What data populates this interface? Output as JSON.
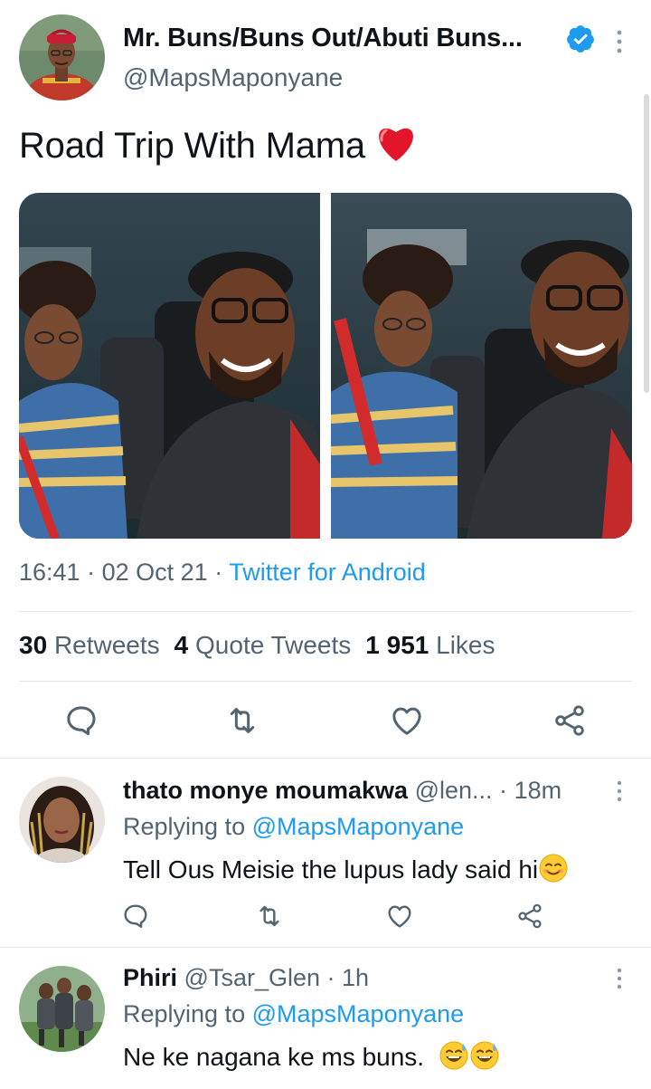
{
  "tweet": {
    "author_name": "Mr. Buns/Buns Out/Abuti Buns...",
    "author_handle": "@MapsMaponyane",
    "verified": true,
    "text": "Road Trip With Mama",
    "emoji": "heart-emoji",
    "time": "16:41",
    "date": "02 Oct 21",
    "separator": "·",
    "source": "Twitter for Android",
    "stats": {
      "retweets_count": "30",
      "retweets_label": "Retweets",
      "quotes_count": "4",
      "quotes_label": "Quote Tweets",
      "likes_count": "1 951",
      "likes_label": "Likes"
    },
    "photos": [
      "photo-selfie-1",
      "photo-selfie-2"
    ],
    "actions": [
      "reply-icon",
      "retweet-icon",
      "like-icon",
      "share-icon"
    ]
  },
  "replies": [
    {
      "name": "thato monye moumakwa",
      "handle": "@len...",
      "time": "18m",
      "replying_label": "Replying to",
      "replying_to": "@MapsMaponyane",
      "text": "Tell Ous Meisie the lupus lady said hi",
      "emoji": "smiling-face-emoji"
    },
    {
      "name": "Phiri",
      "handle": "@Tsar_Glen",
      "time": "1h",
      "replying_label": "Replying to",
      "replying_to": "@MapsMaponyane",
      "text": "Ne ke nagana ke ms buns.",
      "emoji": "sweat-smile-emoji"
    }
  ],
  "colors": {
    "accent": "#1d9bf0",
    "text": "#0f1419",
    "secondary": "#536471",
    "like_red": "#e0245e"
  }
}
